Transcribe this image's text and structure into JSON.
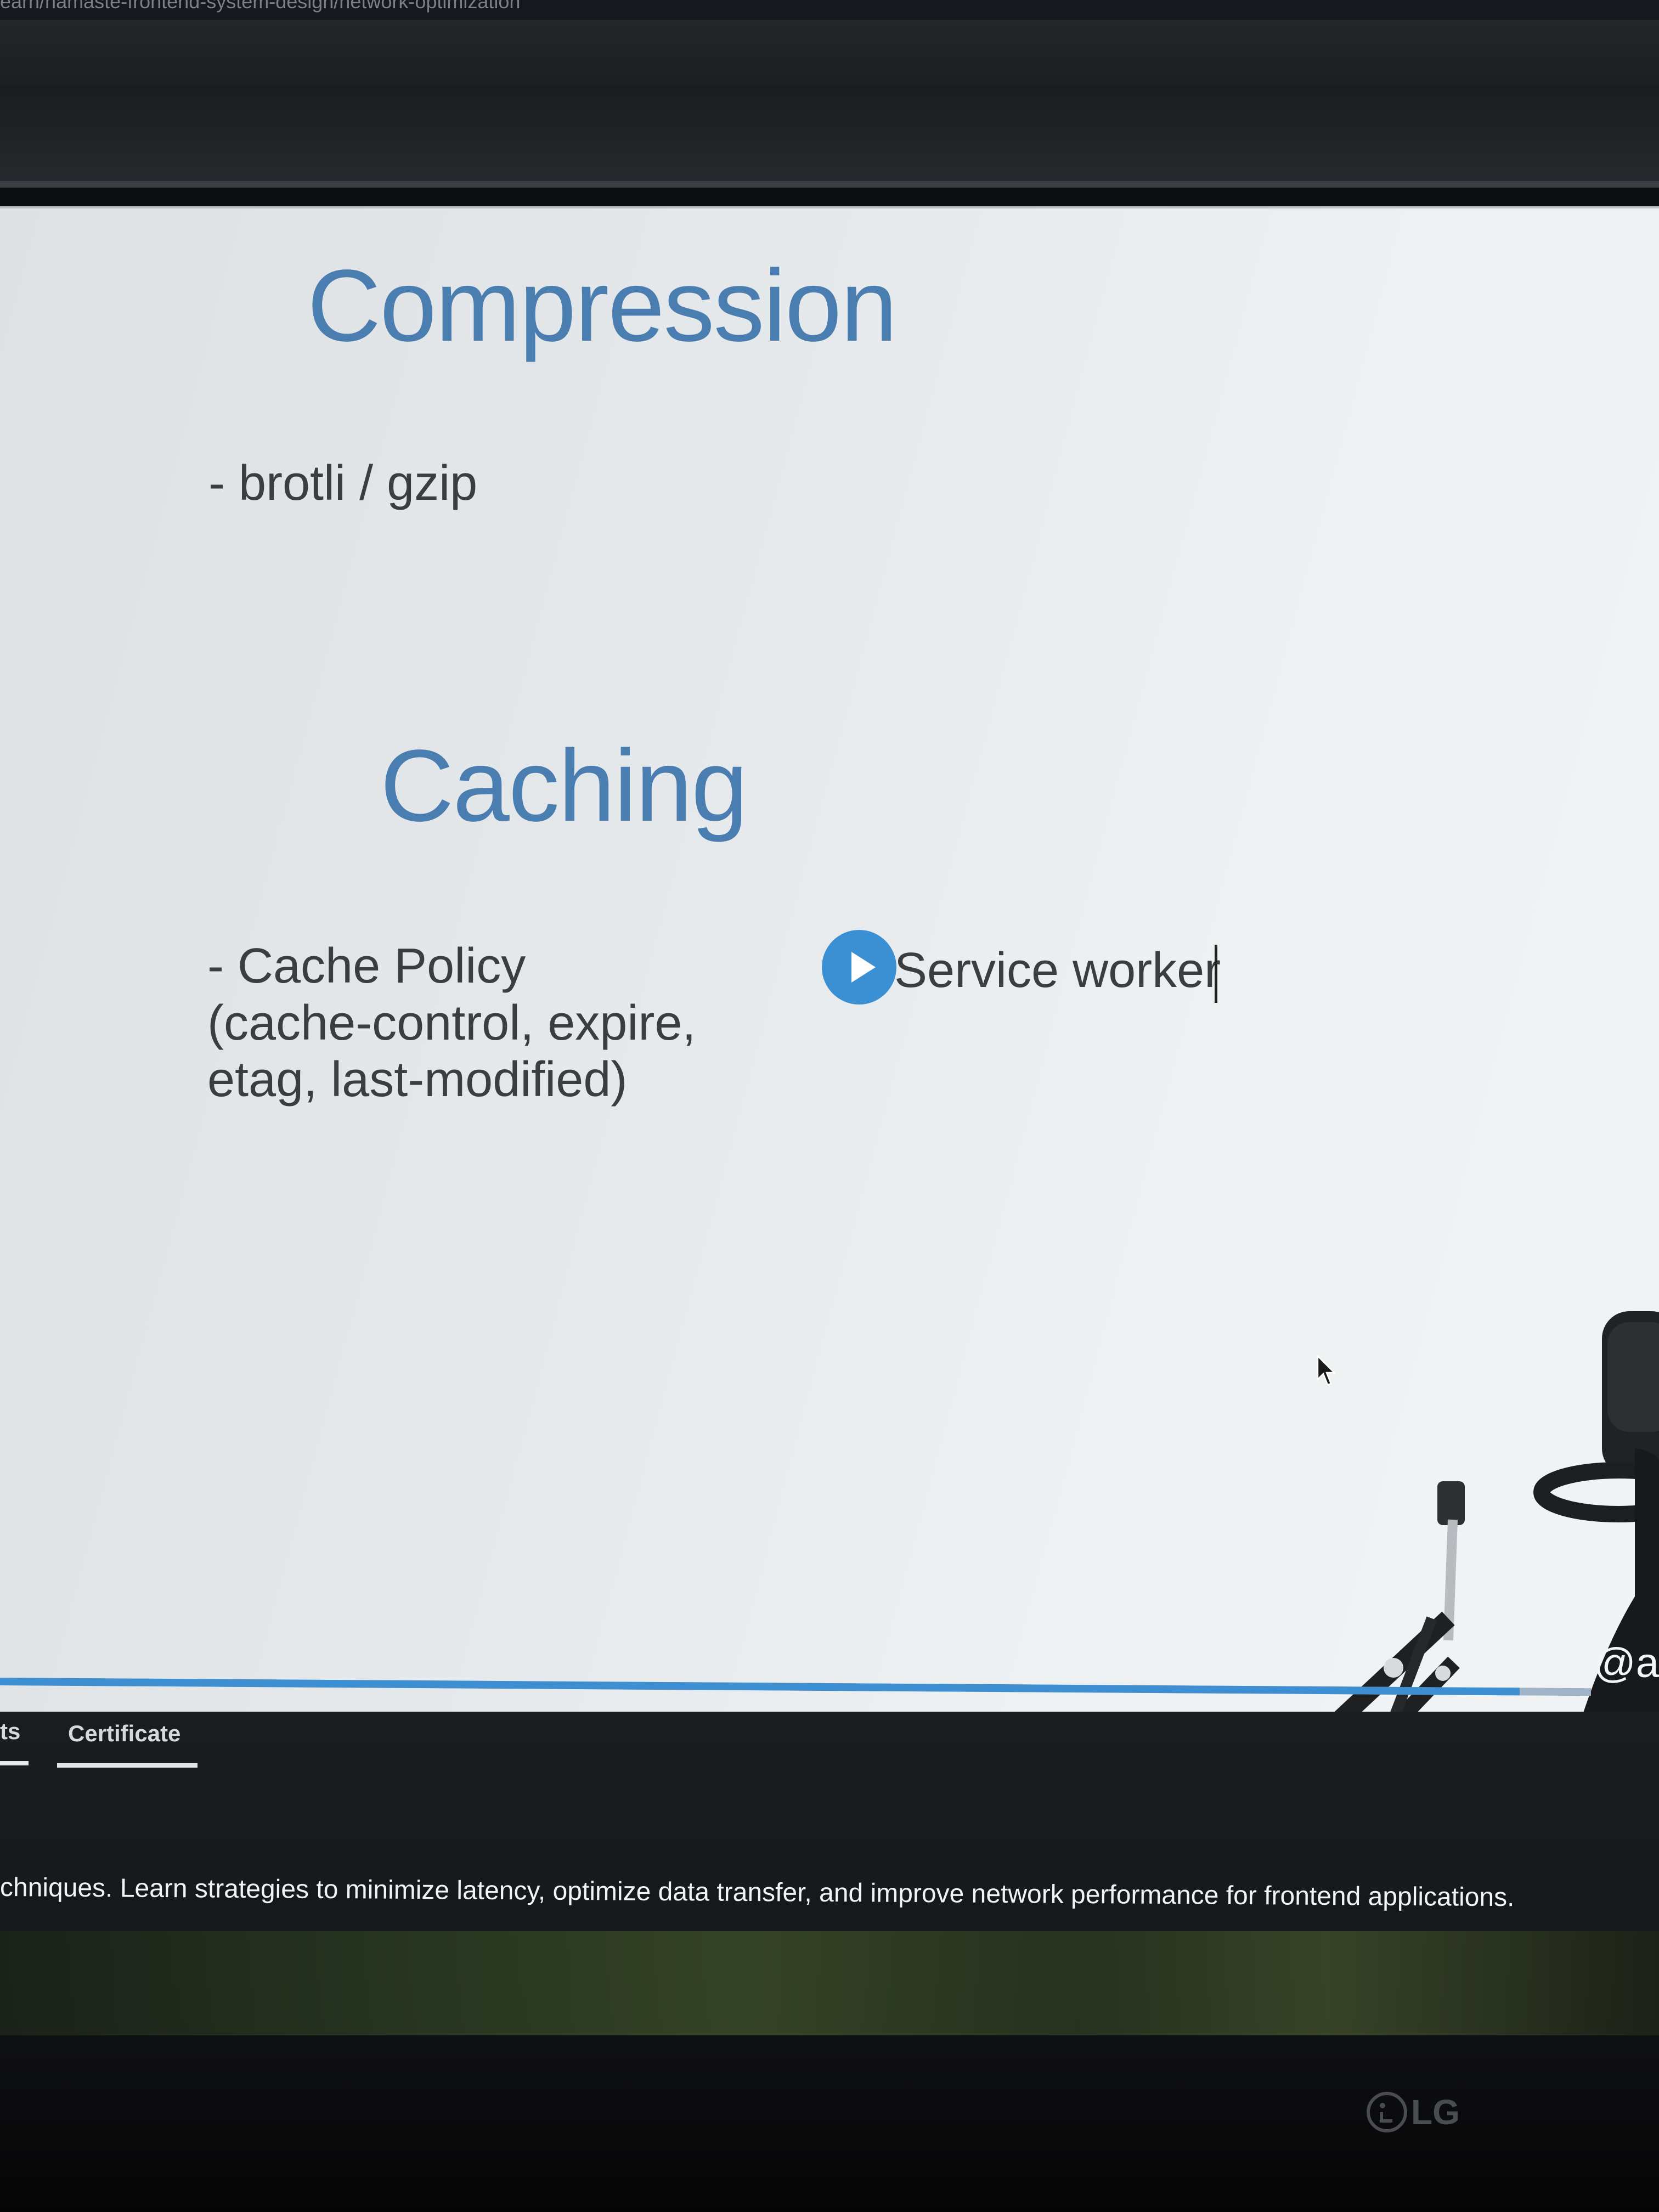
{
  "browser": {
    "url": "earn/namaste-frontend-system-design/network-optimization"
  },
  "slide": {
    "heading_compression": "Compression",
    "bullet_compression": "- brotli / gzip",
    "heading_caching": "Caching",
    "bullet_cache_policy": [
      "- Cache Policy",
      "(cache-control, expire,",
      "etag, last-modified)"
    ],
    "service_worker": "Service worker",
    "watermark_handle": "@a"
  },
  "video": {
    "progress_fraction": 0.955
  },
  "tabs": {
    "partial_tab": "ts",
    "certificate": "Certificate"
  },
  "course": {
    "description": "chniques. Learn strategies to minimize latency, optimize data transfer, and improve network performance for frontend applications."
  },
  "monitor": {
    "brand": "LG"
  },
  "colors": {
    "heading": "#4a7db0",
    "progress": "#3d8fd1",
    "play_badge": "#3b8fd3"
  },
  "icons": [
    "play-icon",
    "mouse-cursor-icon",
    "lg-logo-icon"
  ]
}
